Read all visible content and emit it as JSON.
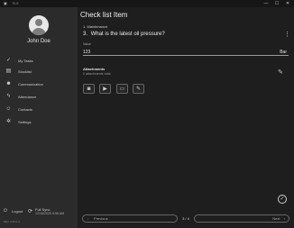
{
  "app": {
    "title": "R-5"
  },
  "window_controls": {
    "minimize": "—",
    "maximize": "☐",
    "close": "✕"
  },
  "user": {
    "name": "John Doe"
  },
  "sidebar": {
    "items": [
      {
        "label": "My Tasks",
        "icon": "check-icon",
        "glyph": "✓"
      },
      {
        "label": "Stocklist",
        "icon": "list-icon",
        "glyph": "▤"
      },
      {
        "label": "Communication",
        "icon": "people-icon",
        "glyph": "☻"
      },
      {
        "label": "Attendance",
        "icon": "bolt-icon",
        "glyph": "ϟ"
      },
      {
        "label": "Contacts",
        "icon": "contacts-icon",
        "glyph": "☺"
      },
      {
        "label": "Settings",
        "icon": "gear-icon",
        "glyph": "✲"
      }
    ],
    "logout_label": "Logout",
    "sync_title": "Full Sync",
    "sync_time": "12/16/2020 9:56 AM",
    "version": "REV 2.20.0.4"
  },
  "main": {
    "title": "Check list Item",
    "section": "1. Maintenance",
    "question_number": "3.",
    "question": "What is the latest oil pressure?",
    "value_label": "Value",
    "value": "123",
    "unit": "Bar",
    "attachments_title": "Attachments",
    "attachments_sub": "0 attachments total",
    "attach_buttons": [
      {
        "name": "camera-button",
        "icon": "camera-icon",
        "glyph": "◙"
      },
      {
        "name": "video-button",
        "icon": "video-icon",
        "glyph": "▶"
      },
      {
        "name": "folder-button",
        "icon": "folder-icon",
        "glyph": "▭"
      },
      {
        "name": "draw-button",
        "icon": "pen-icon",
        "glyph": "✎"
      }
    ]
  },
  "pager": {
    "previous_label": "Previous",
    "next_label": "Next",
    "current": "3",
    "separator": "/",
    "total": "4",
    "count_text": "3 / 4"
  }
}
